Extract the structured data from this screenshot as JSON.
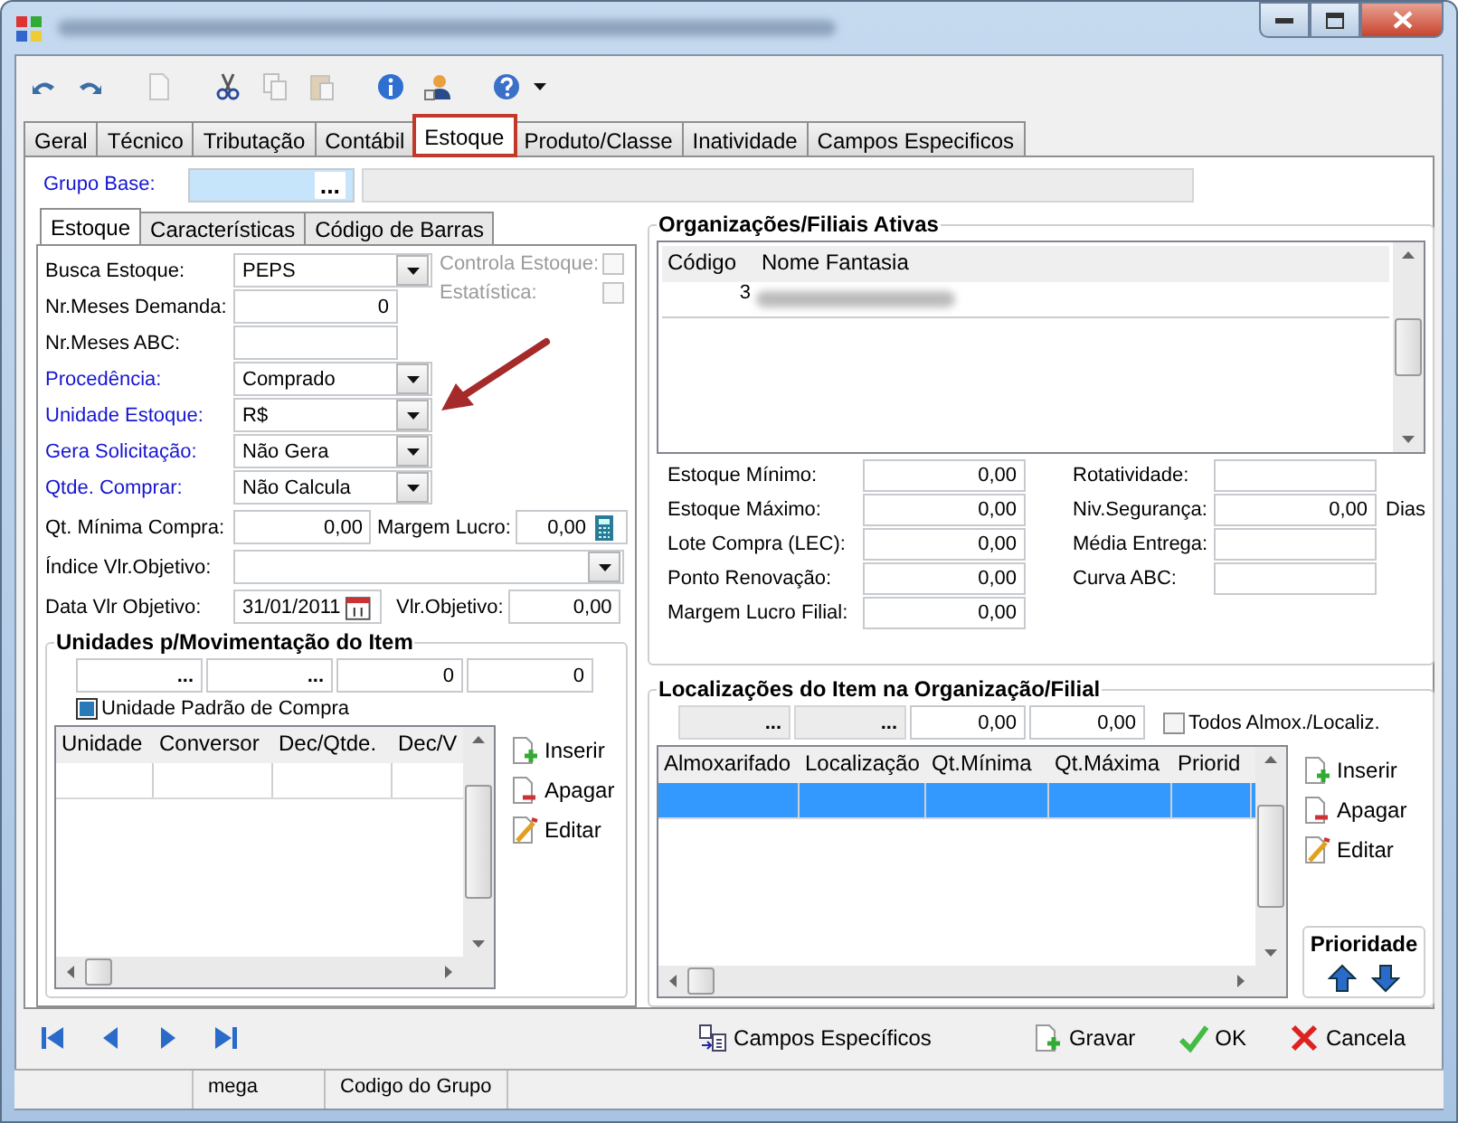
{
  "toolbar": [
    {
      "disabled": false
    },
    {
      "disabled": false
    },
    {
      "disabled": true
    },
    {
      "disabled": false
    },
    {
      "disabled": true
    },
    {
      "disabled": true
    },
    {
      "disabled": false
    },
    {
      "disabled": false
    },
    {
      "disabled": false
    }
  ],
  "tabs": [
    {
      "label": "Geral",
      "selected": false,
      "highlighted": false
    },
    {
      "label": "Técnico",
      "selected": false,
      "highlighted": false
    },
    {
      "label": "Tributação",
      "selected": false,
      "highlighted": false
    },
    {
      "label": "Contábil",
      "selected": false,
      "highlighted": false
    },
    {
      "label": "Estoque",
      "selected": true,
      "highlighted": true
    },
    {
      "label": "Produto/Classe",
      "selected": false,
      "highlighted": false
    },
    {
      "label": "Inatividade",
      "selected": false,
      "highlighted": false
    },
    {
      "label": "Campos Especificos",
      "selected": false,
      "highlighted": false
    }
  ],
  "grupo_base": {
    "label": "Grupo Base:",
    "button": "..."
  },
  "subtabs": [
    {
      "label": "Estoque",
      "selected": true
    },
    {
      "label": "Características",
      "selected": false
    },
    {
      "label": "Código de Barras",
      "selected": false
    }
  ],
  "estoque_form": {
    "fields": [
      {
        "label": "Busca Estoque:",
        "required": false,
        "kind": "combo",
        "value": "PEPS"
      },
      {
        "label": "Nr.Meses Demanda:",
        "required": false,
        "kind": "number",
        "value": "0"
      },
      {
        "label": "Nr.Meses ABC:",
        "required": false,
        "kind": "number"
      },
      {
        "label": "Procedência:",
        "required": true,
        "kind": "combo",
        "value": "Comprado"
      },
      {
        "label": "Unidade Estoque:",
        "required": true,
        "kind": "combo",
        "value": "R$"
      },
      {
        "label": "Gera Solicitação:",
        "required": true,
        "kind": "combo",
        "value": "Não Gera"
      },
      {
        "label": "Qtde. Comprar:",
        "required": true,
        "kind": "combo",
        "value": "Não Calcula"
      }
    ],
    "checks": [
      {
        "label": "Controla Estoque:",
        "disabled": true,
        "checked": false
      },
      {
        "label": "Estatística:",
        "disabled": true,
        "checked": false
      }
    ],
    "qt_minima": {
      "label": "Qt. Mínima Compra:",
      "value": "0,00"
    },
    "margem_lucro": {
      "label": "Margem Lucro:",
      "value": "0,00"
    },
    "indice": {
      "label": "Índice Vlr.Objetivo:"
    },
    "data_objetivo": {
      "label": "Data Vlr Objetivo:",
      "value": "31/01/2011"
    },
    "vlr_objetivo": {
      "label": "Vlr.Objetivo:",
      "value": "0,00"
    }
  },
  "unidades": {
    "title": "Unidades p/Movimentação do Item",
    "inputs": [
      {
        "kind": "lookup",
        "value": "..."
      },
      {
        "kind": "lookup",
        "value": "..."
      },
      {
        "kind": "number",
        "value": "0"
      },
      {
        "kind": "number",
        "value": "0"
      }
    ],
    "default_check": {
      "label": "Unidade Padrão de Compra",
      "checked": true
    },
    "columns": [
      "Unidade",
      "Conversor",
      "Dec/Qtde.",
      "Dec/V"
    ],
    "rows": [
      {
        "selected": false
      }
    ],
    "buttons": [
      {
        "kind": "insert",
        "label": "Inserir"
      },
      {
        "kind": "delete",
        "label": "Apagar"
      },
      {
        "kind": "edit",
        "label": "Editar"
      }
    ]
  },
  "organizacoes": {
    "title": "Organizações/Filiais Ativas",
    "columns": [
      "Código",
      "Nome Fantasia"
    ],
    "rows": [
      {
        "code": "3"
      }
    ],
    "fields_left": [
      {
        "label": "Estoque Mínimo:",
        "value": "0,00"
      },
      {
        "label": "Estoque Máximo:",
        "value": "0,00"
      },
      {
        "label": "Lote Compra (LEC):",
        "value": "0,00"
      },
      {
        "label": "Ponto Renovação:",
        "value": "0,00"
      },
      {
        "label": "Margem Lucro Filial:",
        "value": "0,00"
      }
    ],
    "fields_right": [
      {
        "label": "Rotatividade:"
      },
      {
        "label": "Niv.Segurança:",
        "value": "0,00",
        "unit": "Dias"
      },
      {
        "label": "Média Entrega:"
      },
      {
        "label": "Curva ABC:"
      }
    ]
  },
  "localizacoes": {
    "title": "Localizações do Item na Organização/Filial",
    "inputs": [
      {
        "kind": "lookup",
        "value": "..."
      },
      {
        "kind": "lookup",
        "value": "..."
      },
      {
        "kind": "number",
        "value": "0,00"
      },
      {
        "kind": "number",
        "value": "0,00"
      }
    ],
    "all_check": {
      "label": "Todos Almox./Localiz.",
      "checked": false
    },
    "columns": [
      "Almoxarifado",
      "Localização",
      "Qt.Mínima",
      "Qt.Máxima",
      "Priorid"
    ],
    "rows": [
      {
        "selected": true
      }
    ],
    "buttons": [
      {
        "kind": "insert",
        "label": "Inserir"
      },
      {
        "kind": "delete",
        "label": "Apagar"
      },
      {
        "kind": "edit",
        "label": "Editar"
      }
    ],
    "priority": {
      "title": "Prioridade"
    }
  },
  "footer": {
    "buttons": [
      {
        "kind": "fields",
        "label": "Campos Específicos"
      },
      {
        "kind": "save",
        "label": "Gravar"
      },
      {
        "kind": "ok",
        "label": "OK"
      },
      {
        "kind": "cancel",
        "label": "Cancela"
      }
    ]
  },
  "status_bar": [
    "mega",
    "Codigo do Grupo"
  ]
}
